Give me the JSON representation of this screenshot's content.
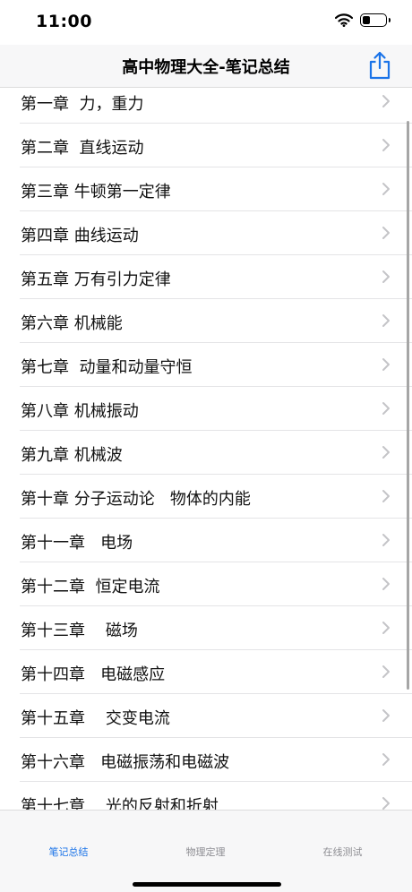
{
  "status": {
    "time": "11:00",
    "wifi_icon": "wifi-icon",
    "battery_icon": "battery-icon",
    "battery_level": 0.35
  },
  "nav": {
    "title": "高中物理大全-笔记总结",
    "share_icon": "share-icon",
    "accent_color": "#1a73e8"
  },
  "chapters": [
    "第一章  力，重力",
    "第二章  直线运动",
    "第三章 牛顿第一定律",
    "第四章 曲线运动",
    "第五章 万有引力定律",
    "第六章 机械能",
    "第七章  动量和动量守恒",
    "第八章 机械振动",
    "第九章 机械波",
    "第十章 分子运动论   物体的内能",
    "第十一章   电场",
    "第十二章  恒定电流",
    "第十三章    磁场",
    "第十四章   电磁感应",
    "第十五章    交变电流",
    "第十六章   电磁振荡和电磁波",
    "第十七章    光的反射和折射"
  ],
  "tabs": [
    {
      "label": "笔记总结",
      "active": true
    },
    {
      "label": "物理定理",
      "active": false
    },
    {
      "label": "在线测试",
      "active": false
    }
  ]
}
